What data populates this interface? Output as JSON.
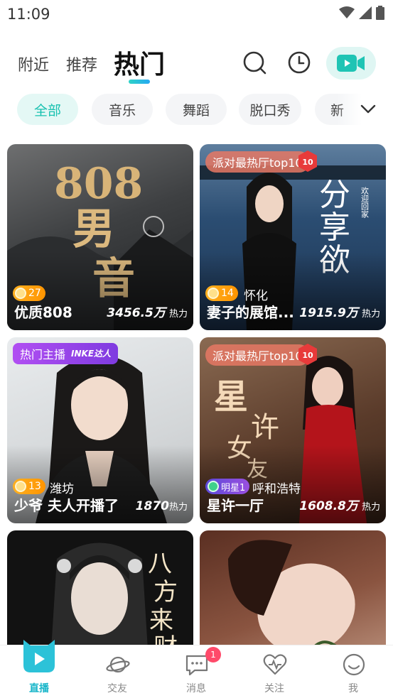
{
  "status_bar": {
    "time": "11:09"
  },
  "top_tabs": [
    {
      "label": "附近"
    },
    {
      "label": "推荐"
    },
    {
      "label": "热门",
      "active": true
    }
  ],
  "categories": [
    {
      "label": "全部",
      "active": true
    },
    {
      "label": "音乐"
    },
    {
      "label": "舞蹈"
    },
    {
      "label": "脱口秀"
    },
    {
      "label": "新"
    }
  ],
  "cards": [
    {
      "title": "优质808",
      "level": "27",
      "heat": "3456.5万",
      "heat_unit": "热力",
      "art_text": [
        "808",
        "男",
        "音"
      ]
    },
    {
      "badge": "派对最热厅top10",
      "level": "14",
      "city": "怀化",
      "title": "妻子的展馆...",
      "heat": "1915.9万",
      "heat_unit": "热力",
      "art_text": [
        "分",
        "享",
        "欲",
        "欢迎回家"
      ]
    },
    {
      "badge": "热门主播",
      "badge_extra": "INKE达人",
      "level": "13",
      "city": "潍坊",
      "title": "少爷 夫人开播了",
      "heat": "1870",
      "heat_unit": "热力"
    },
    {
      "badge": "派对最热厅top10",
      "star_badge": "明星1",
      "city": "呼和浩特",
      "title": "星许一厅",
      "heat": "1608.8万",
      "heat_unit": "热力",
      "art_text": [
        "星",
        "许",
        "女",
        "友"
      ]
    },
    {
      "art_text": [
        "八",
        "方",
        "来",
        "财"
      ]
    },
    {}
  ],
  "bottom_nav": [
    {
      "label": "直播",
      "active": true
    },
    {
      "label": "交友"
    },
    {
      "label": "消息",
      "badge": "1"
    },
    {
      "label": "关注"
    },
    {
      "label": "我"
    }
  ],
  "colors": {
    "accent": "#18c1b0",
    "nav_active": "#17b5c9",
    "badge_red": "#ff4a6a"
  }
}
